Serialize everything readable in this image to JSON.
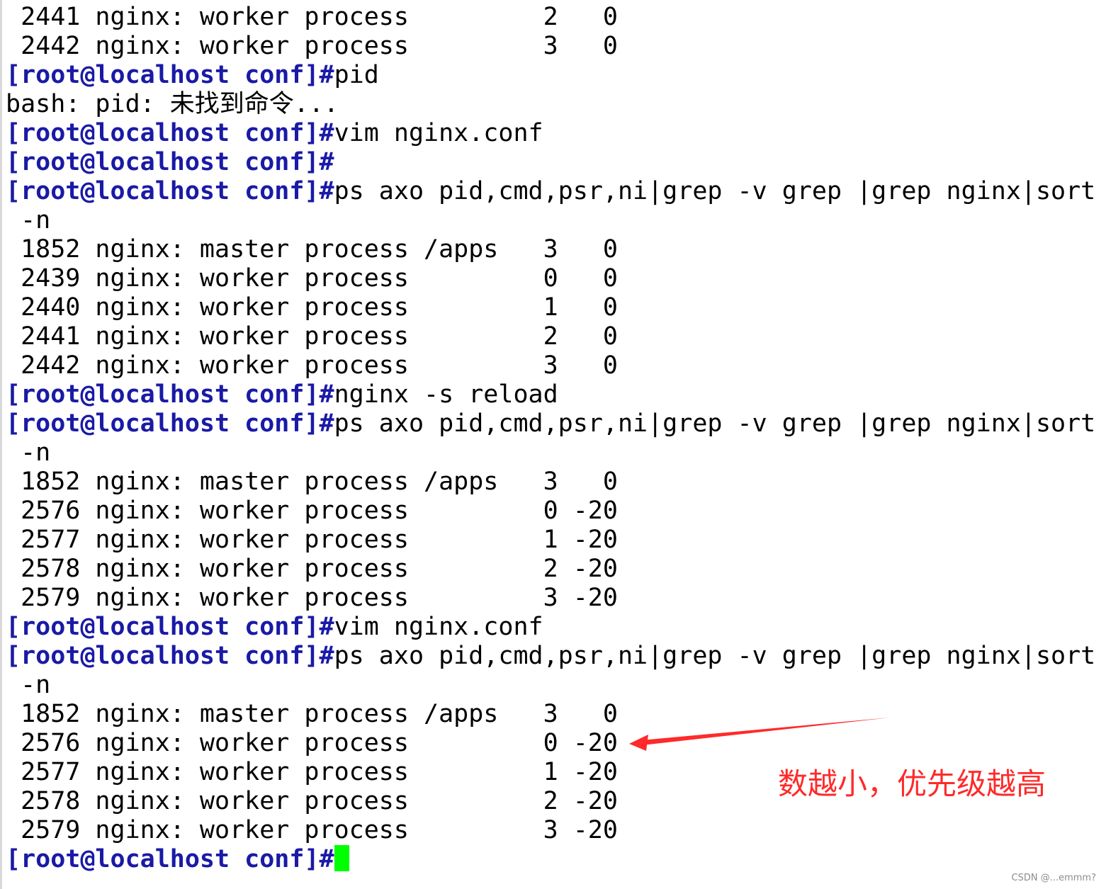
{
  "terminal": {
    "prompt": "[root@localhost conf]#",
    "lines": [
      {
        "type": "out",
        "text": " 2441 nginx: worker process         2   0"
      },
      {
        "type": "out",
        "text": " 2442 nginx: worker process         3   0"
      },
      {
        "type": "cmd",
        "text": "pid"
      },
      {
        "type": "out",
        "text": "bash: pid: 未找到命令..."
      },
      {
        "type": "cmd",
        "text": "vim nginx.conf"
      },
      {
        "type": "cmd",
        "text": ""
      },
      {
        "type": "cmd",
        "text": "ps axo pid,cmd,psr,ni|grep -v grep |grep nginx|sort"
      },
      {
        "type": "out",
        "text": " -n"
      },
      {
        "type": "out",
        "text": " 1852 nginx: master process /apps   3   0"
      },
      {
        "type": "out",
        "text": " 2439 nginx: worker process         0   0"
      },
      {
        "type": "out",
        "text": " 2440 nginx: worker process         1   0"
      },
      {
        "type": "out",
        "text": " 2441 nginx: worker process         2   0"
      },
      {
        "type": "out",
        "text": " 2442 nginx: worker process         3   0"
      },
      {
        "type": "cmd",
        "text": "nginx -s reload"
      },
      {
        "type": "cmd",
        "text": "ps axo pid,cmd,psr,ni|grep -v grep |grep nginx|sort"
      },
      {
        "type": "out",
        "text": " -n"
      },
      {
        "type": "out",
        "text": " 1852 nginx: master process /apps   3   0"
      },
      {
        "type": "out",
        "text": " 2576 nginx: worker process         0 -20"
      },
      {
        "type": "out",
        "text": " 2577 nginx: worker process         1 -20"
      },
      {
        "type": "out",
        "text": " 2578 nginx: worker process         2 -20"
      },
      {
        "type": "out",
        "text": " 2579 nginx: worker process         3 -20"
      },
      {
        "type": "cmd",
        "text": "vim nginx.conf"
      },
      {
        "type": "cmd",
        "text": "ps axo pid,cmd,psr,ni|grep -v grep |grep nginx|sort"
      },
      {
        "type": "out",
        "text": " -n"
      },
      {
        "type": "out",
        "text": " 1852 nginx: master process /apps   3   0"
      },
      {
        "type": "out",
        "text": " 2576 nginx: worker process         0 -20"
      },
      {
        "type": "out",
        "text": " 2577 nginx: worker process         1 -20"
      },
      {
        "type": "out",
        "text": " 2578 nginx: worker process         2 -20"
      },
      {
        "type": "out",
        "text": " 2579 nginx: worker process         3 -20"
      },
      {
        "type": "cmd",
        "text": "",
        "cursor": true
      }
    ]
  },
  "annotation": {
    "text": "数越小，优先级越高",
    "color": "#ff2a2a"
  },
  "colors": {
    "prompt": "#1a1aa6",
    "cursor": "#00ff00",
    "text": "#000000",
    "background": "#ffffff"
  },
  "watermark": "CSDN @...emmm?"
}
